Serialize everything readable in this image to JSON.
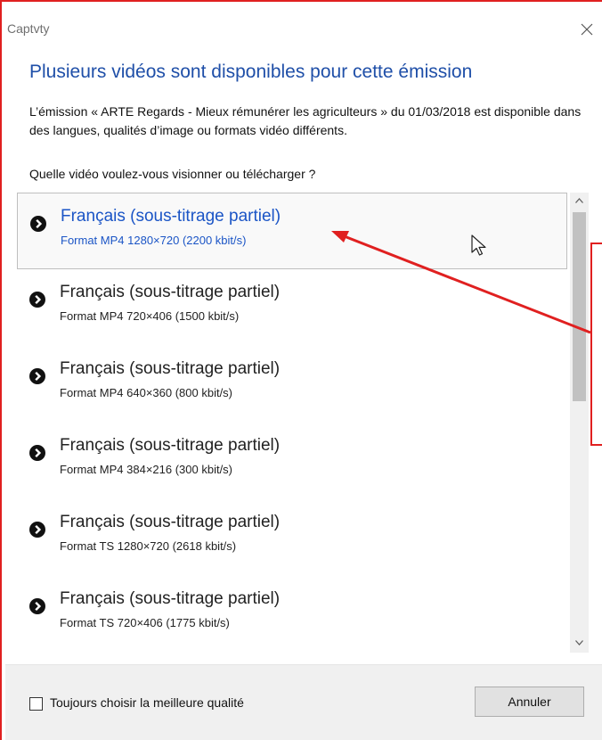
{
  "window": {
    "title": "Captvty"
  },
  "dialog": {
    "heading": "Plusieurs vidéos sont disponibles pour cette émission",
    "description": "L’émission « ARTE Regards - Mieux rémunérer les agriculteurs » du 01/03/2018 est disponible dans des langues, qualités d’image ou formats vidéo différents.",
    "prompt": "Quelle vidéo voulez-vous visionner ou télécharger ?"
  },
  "videos": [
    {
      "title": "Français (sous-titrage partiel)",
      "format": "Format MP4 1280×720 (2200 kbit/s)",
      "selected": true
    },
    {
      "title": "Français (sous-titrage partiel)",
      "format": "Format MP4 720×406 (1500 kbit/s)",
      "selected": false
    },
    {
      "title": "Français (sous-titrage partiel)",
      "format": "Format MP4 640×360 (800 kbit/s)",
      "selected": false
    },
    {
      "title": "Français (sous-titrage partiel)",
      "format": "Format MP4 384×216 (300 kbit/s)",
      "selected": false
    },
    {
      "title": "Français (sous-titrage partiel)",
      "format": "Format TS 1280×720 (2618 kbit/s)",
      "selected": false
    },
    {
      "title": "Français (sous-titrage partiel)",
      "format": "Format TS 720×406 (1775 kbit/s)",
      "selected": false
    }
  ],
  "footer": {
    "checkbox_label": "Toujours choisir la meilleure qualité",
    "checkbox_checked": false,
    "cancel_label": "Annuler"
  },
  "colors": {
    "accent": "#1b55c6",
    "heading": "#1f4fa8",
    "annotation": "#e02020"
  },
  "icons": {
    "bullet": "chevron-circle-icon",
    "close": "close-icon",
    "cursor": "mouse-pointer-icon"
  }
}
